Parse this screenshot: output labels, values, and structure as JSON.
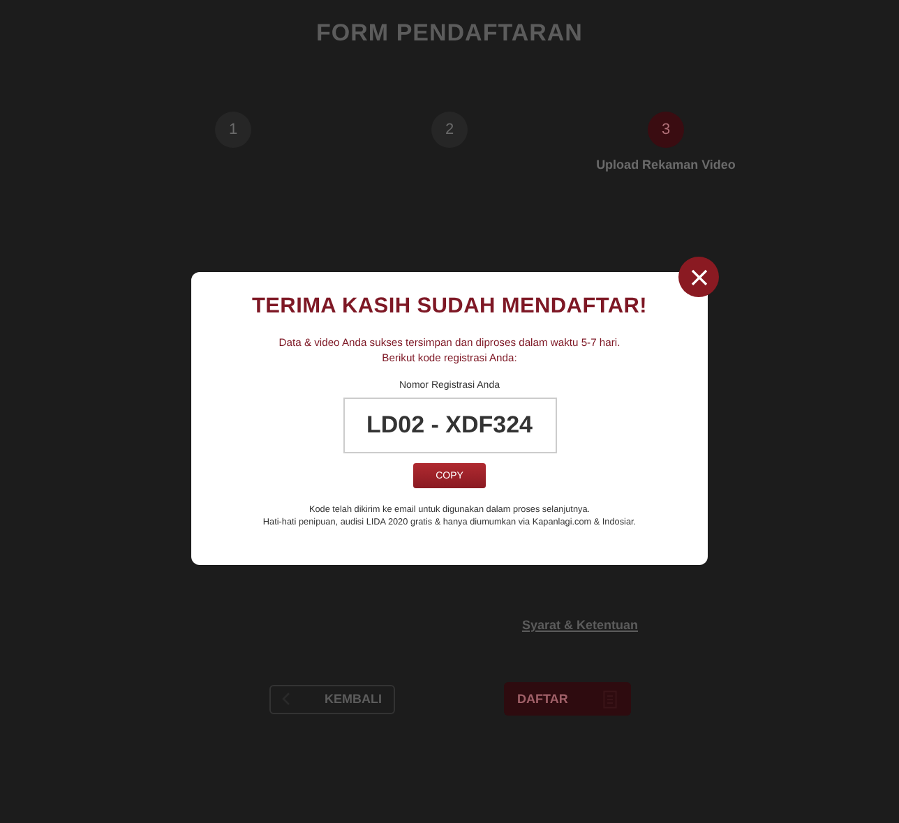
{
  "page": {
    "title": "FORM PENDAFTARAN"
  },
  "steps": [
    {
      "number": "1",
      "selected": false
    },
    {
      "number": "2",
      "selected": false
    },
    {
      "number": "3",
      "label": "Upload Rekaman Video",
      "selected": true
    }
  ],
  "consent": {
    "link": "Syarat & Ketentuan"
  },
  "buttons": [
    {
      "kind": "back",
      "label": "KEMBALI"
    },
    {
      "kind": "submit",
      "label": "DAFTAR"
    }
  ],
  "modal": {
    "title": "TERIMA KASIH SUDAH MENDAFTAR!",
    "message": [
      "Data & video Anda sukses tersimpan dan diproses dalam waktu 5-7 hari.",
      "Berikut kode registrasi Anda:"
    ],
    "code_label": "Nomor Registrasi Anda",
    "code": "LD02 - XDF324",
    "copy_button": "COPY",
    "notes": [
      "Kode telah dikirim ke email untuk digunakan dalam proses selanjutnya.",
      "Hati-hati penipuan, audisi LIDA 2020 gratis & hanya diumumkan via Kapanlagi.com & Indosiar."
    ]
  }
}
